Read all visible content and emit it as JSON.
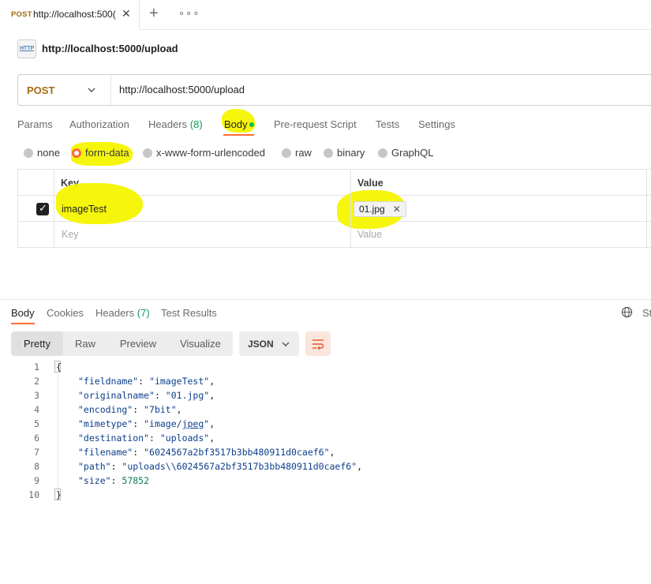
{
  "tab": {
    "method": "POST",
    "url": "http://localhost:500(",
    "close": "✕"
  },
  "tabstrip": {
    "plus": "+",
    "more": "∘∘∘"
  },
  "request": {
    "icon_text": "HTTP",
    "title": "http://localhost:5000/upload",
    "method": "POST",
    "url": "http://localhost:5000/upload"
  },
  "request_tabs": [
    {
      "label": "Params"
    },
    {
      "label": "Authorization"
    },
    {
      "label": "Headers",
      "count": "(8)"
    },
    {
      "label": "Body"
    },
    {
      "label": "Pre-request Script"
    },
    {
      "label": "Tests"
    },
    {
      "label": "Settings"
    }
  ],
  "body_types": [
    "none",
    "form-data",
    "x-www-form-urlencoded",
    "raw",
    "binary",
    "GraphQL"
  ],
  "body_type_selected": "form-data",
  "form_table": {
    "headers": [
      "Key",
      "Value"
    ],
    "rows": [
      {
        "checked": true,
        "key": "imageTest",
        "value": "01.jpg"
      }
    ],
    "key_placeholder": "Key",
    "value_placeholder": "Value"
  },
  "response": {
    "tabs": [
      {
        "label": "Body"
      },
      {
        "label": "Cookies"
      },
      {
        "label": "Headers",
        "count": "(7)"
      },
      {
        "label": "Test Results"
      }
    ],
    "status_label": "St",
    "view_modes": [
      "Pretty",
      "Raw",
      "Preview",
      "Visualize"
    ],
    "active_view": "Pretty",
    "format": "JSON",
    "lines": [
      {
        "n": "1",
        "text": "{"
      },
      {
        "n": "2",
        "key": "\"fieldname\"",
        "value": "\"imageTest\"",
        "comma": ","
      },
      {
        "n": "3",
        "key": "\"originalname\"",
        "value": "\"01.jpg\"",
        "comma": ","
      },
      {
        "n": "4",
        "key": "\"encoding\"",
        "value": "\"7bit\"",
        "comma": ","
      },
      {
        "n": "5",
        "key": "\"mimetype\"",
        "value_pre": "\"image/",
        "value_link": "jpeg",
        "value_post": "\"",
        "comma": ","
      },
      {
        "n": "6",
        "key": "\"destination\"",
        "value": "\"uploads\"",
        "comma": ","
      },
      {
        "n": "7",
        "key": "\"filename\"",
        "value": "\"6024567a2bf3517b3bb480911d0caef6\"",
        "comma": ","
      },
      {
        "n": "8",
        "key": "\"path\"",
        "value": "\"uploads\\\\6024567a2bf3517b3bb480911d0caef6\"",
        "comma": ","
      },
      {
        "n": "9",
        "key": "\"size\"",
        "number": "57852",
        "comma": ""
      },
      {
        "n": "10",
        "text": "}"
      }
    ]
  },
  "colors": {
    "accent": "#ff6c37",
    "method": "#a26b12",
    "annotation": "#f5f500",
    "count": "#0f9d58"
  },
  "icons": [
    "close-icon",
    "plus-icon",
    "more-icon",
    "http-icon",
    "chevron-down-icon",
    "check-icon",
    "globe-icon",
    "wrap-lines-icon"
  ]
}
